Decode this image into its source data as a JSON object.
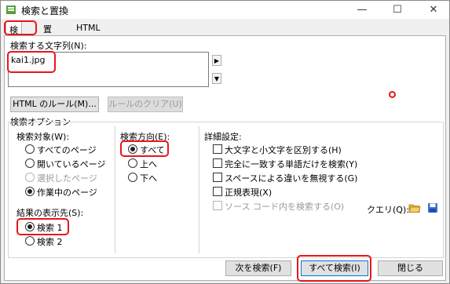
{
  "window": {
    "title": "検索と置換",
    "minimize_label": "—",
    "maximize_label": "☐",
    "close_label": "✕"
  },
  "tabs": [
    {
      "label": "検索"
    },
    {
      "label": "置換"
    },
    {
      "label": "HTML タグ"
    }
  ],
  "search": {
    "label": "検索する文字列(N):",
    "value": "kai1.jpg",
    "html_rules_label": "HTML のルール(M)...",
    "clear_rules_label": "ルールのクリア(U)"
  },
  "options": {
    "title": "検索オプション",
    "target": {
      "label": "検索対象(W):",
      "items": [
        {
          "label": "すべてのページ",
          "selected": false,
          "enabled": true
        },
        {
          "label": "開いているページ",
          "selected": false,
          "enabled": true
        },
        {
          "label": "選択したページ",
          "selected": false,
          "enabled": false
        },
        {
          "label": "作業中のページ",
          "selected": true,
          "enabled": true
        }
      ]
    },
    "results": {
      "label": "結果の表示先(S):",
      "items": [
        {
          "label": "検索 1",
          "selected": true
        },
        {
          "label": "検索 2",
          "selected": false
        }
      ]
    },
    "direction": {
      "label": "検索方向(E):",
      "items": [
        {
          "label": "すべて",
          "selected": true
        },
        {
          "label": "上へ",
          "selected": false
        },
        {
          "label": "下へ",
          "selected": false
        }
      ]
    },
    "details": {
      "label": "詳細設定:",
      "items": [
        {
          "label": "大文字と小文字を区別する(H)",
          "enabled": true
        },
        {
          "label": "完全に一致する単語だけを検索(Y)",
          "enabled": true
        },
        {
          "label": "スペースによる違いを無視する(G)",
          "enabled": true
        },
        {
          "label": "正規表現(X)",
          "enabled": true
        },
        {
          "label": "ソース コード内を検索する(O)",
          "enabled": false
        }
      ],
      "query_label": "クエリ(Q):"
    }
  },
  "footer": {
    "find_next_label": "次を検索(F)",
    "find_all_label": "すべて検索(I)",
    "close_label": "閉じる"
  },
  "colors": {
    "highlight": "#e8161b",
    "window_bg": "#f0f0f0",
    "folder": "#e8b43a",
    "save": "#3a6fd8"
  }
}
